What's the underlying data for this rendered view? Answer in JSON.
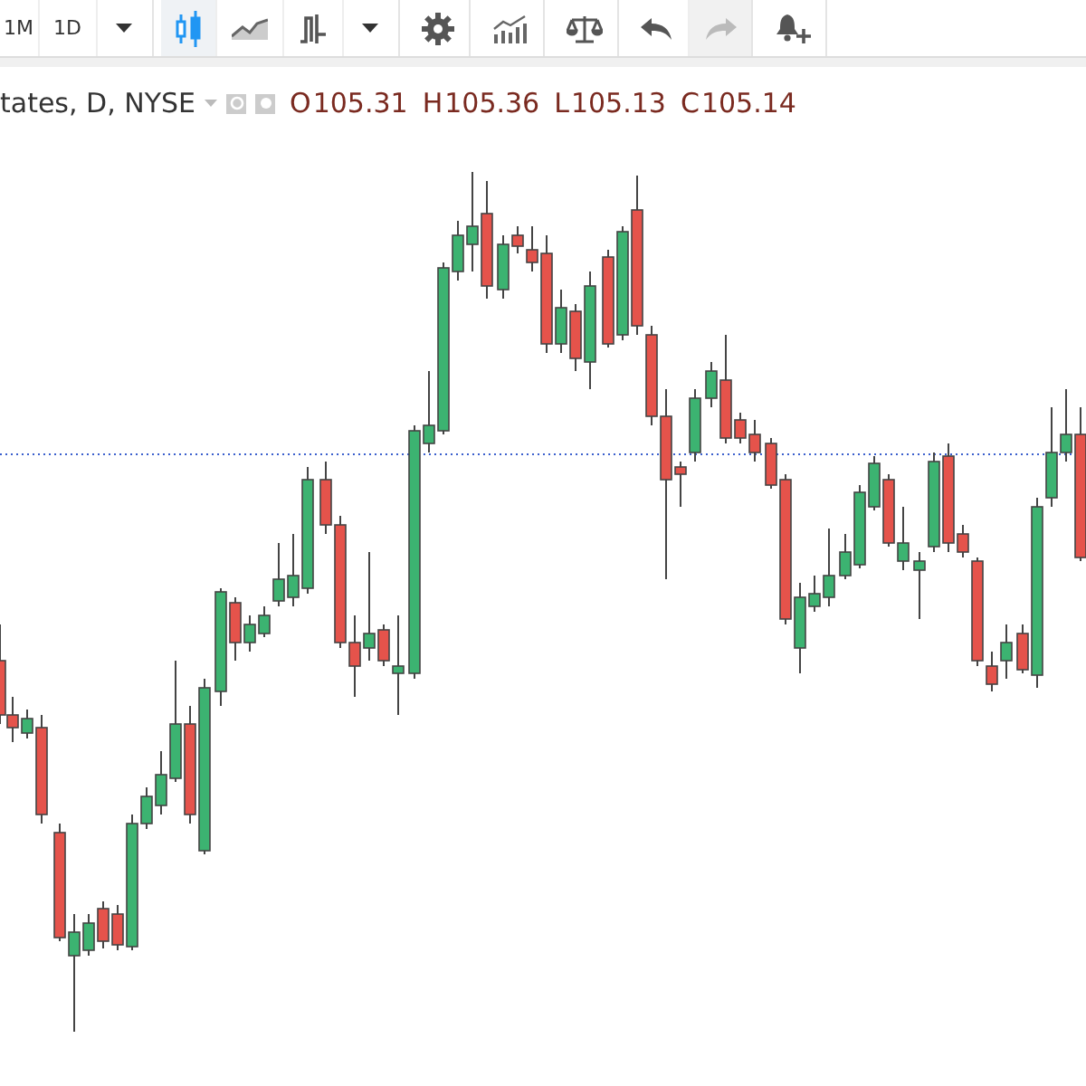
{
  "toolbar": {
    "groups": [
      {
        "items": [
          {
            "kind": "text",
            "label": "1M",
            "selected": false
          },
          {
            "kind": "text",
            "label": "1D",
            "selected": false
          },
          {
            "kind": "caret",
            "selected": false
          }
        ]
      },
      {
        "items": [
          {
            "kind": "candles",
            "selected": true
          },
          {
            "kind": "area",
            "selected": false
          },
          {
            "kind": "indicators",
            "selected": false
          },
          {
            "kind": "caret",
            "selected": false
          }
        ]
      },
      {
        "items": [
          {
            "kind": "settings",
            "selected": false
          }
        ]
      },
      {
        "items": [
          {
            "kind": "bars",
            "selected": false
          }
        ]
      },
      {
        "items": [
          {
            "kind": "compare",
            "selected": false
          }
        ]
      },
      {
        "items": [
          {
            "kind": "undo",
            "disabled": false
          },
          {
            "kind": "redo",
            "disabled": true
          }
        ]
      },
      {
        "items": [
          {
            "kind": "alert",
            "selected": false
          }
        ]
      }
    ]
  },
  "legend": {
    "symbol": "tates, D, NYSE",
    "ohlc": [
      {
        "label": "O",
        "value": "105.31"
      },
      {
        "label": "H",
        "value": "105.36"
      },
      {
        "label": "L",
        "value": "105.13"
      },
      {
        "label": "C",
        "value": "105.14"
      }
    ]
  }
}
